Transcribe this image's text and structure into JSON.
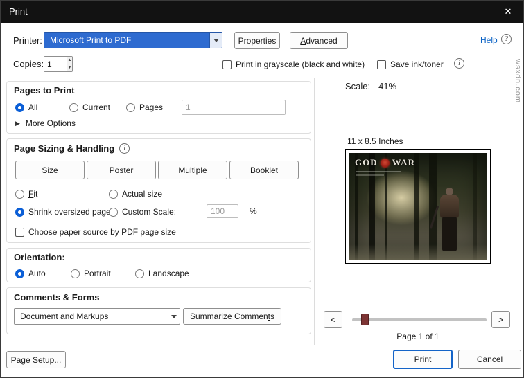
{
  "window": {
    "title": "Print",
    "close_glyph": "✕"
  },
  "watermark": "wsxdn.com",
  "icons": {
    "info": "i",
    "help": "?",
    "up": "▲",
    "down": "▼",
    "collapsed": "▶"
  },
  "printer": {
    "label": "Printer:",
    "value": "Microsoft Print to PDF",
    "properties": "Properties",
    "advanced_u": "A",
    "advanced_rest": "dvanced",
    "help": "Help"
  },
  "copies": {
    "label": "Copies:",
    "value": "1",
    "grayscale": "Print in grayscale (black and white)",
    "save_ink": "Save ink/toner"
  },
  "pages": {
    "title": "Pages to Print",
    "all": "All",
    "current": "Current",
    "pages": "Pages",
    "pages_value": "1",
    "more_options": "More Options"
  },
  "sizing": {
    "title": "Page Sizing & Handling",
    "size_u": "S",
    "size_rest": "ize",
    "poster": "Poster",
    "multiple": "Multiple",
    "booklet": "Booklet",
    "fit_u": "F",
    "fit_rest": "it",
    "actual": "Actual size",
    "shrink": "Shrink oversized pages",
    "custom": "Custom Scale:",
    "custom_value": "100",
    "percent": "%",
    "paper_source": "Choose paper source by PDF page size"
  },
  "orientation": {
    "title": "Orientation:",
    "auto": "Auto",
    "portrait": "Portrait",
    "landscape": "Landscape"
  },
  "comments": {
    "title": "Comments & Forms",
    "selected": "Document and Markups",
    "summarize_pre": "Summarize Commen",
    "summarize_u": "t",
    "summarize_post": "s"
  },
  "preview": {
    "scale_label": "Scale:",
    "scale_value": "41%",
    "page_size": "11 x 8.5 Inches",
    "page_indicator": "Page 1 of 1",
    "prev": "<",
    "next": ">",
    "logo_god": "GOD",
    "logo_war": "WAR"
  },
  "footer": {
    "page_setup": "Page Setup...",
    "print": "Print",
    "cancel": "Cancel"
  },
  "colors": {
    "titlebar": "#121212",
    "selection_blue": "#2e6bd0",
    "radio_blue": "#0b5fd7",
    "default_button_border": "#1464c8",
    "help_link": "#0b63c5"
  }
}
